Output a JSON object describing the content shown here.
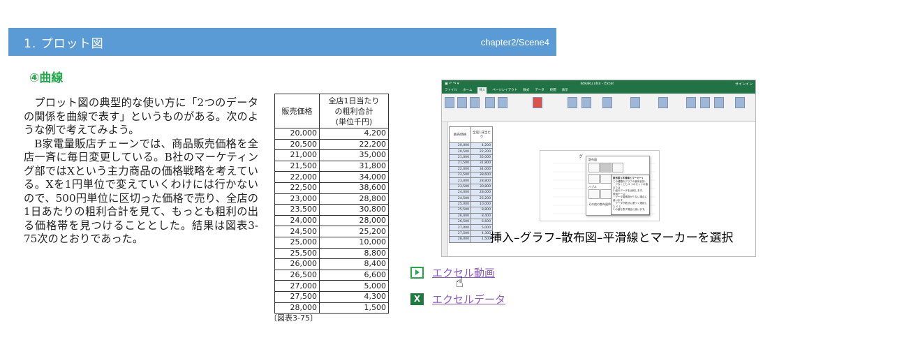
{
  "header": {
    "title": "1. プロット図",
    "scene": "chapter2/Scene4",
    "bg": "#5b9bd5"
  },
  "subtitle": "④曲線",
  "body": {
    "p1": "プロット図の典型的な使い方に「2つのデータの関係を曲線で表す」というものがある。次のような例で考えてみよう。",
    "p2": "B家電量販店チェーンでは、商品販売価格を全店一斉に毎日変更している。B社のマーケティング部ではXという主力商品の価格戦略を考えている。Xを1円単位で変えていくわけには行かないので、500円単位に区切った価格で売り、全店の1日あたりの粗利合計を見て、もっとも粗利の出る価格帯を見つけることとした。結果は図表3-75次のとおりであった。"
  },
  "table": {
    "h1": "販売価格",
    "h2a": "全店1日当たり",
    "h2b": "の粗利合計",
    "h2c": "(単位千円)",
    "rows": [
      [
        "20,000",
        "4,200"
      ],
      [
        "20,500",
        "22,200"
      ],
      [
        "21,000",
        "35,000"
      ],
      [
        "21,500",
        "31,800"
      ],
      [
        "22,000",
        "34,000"
      ],
      [
        "22,500",
        "38,600"
      ],
      [
        "23,000",
        "28,800"
      ],
      [
        "23,500",
        "30,800"
      ],
      [
        "24,000",
        "28,000"
      ],
      [
        "24,500",
        "25,200"
      ],
      [
        "25,000",
        "10,000"
      ],
      [
        "25,500",
        "8,800"
      ],
      [
        "26,000",
        "8,400"
      ],
      [
        "26,500",
        "6,600"
      ],
      [
        "27,000",
        "5,000"
      ],
      [
        "27,500",
        "4,300"
      ],
      [
        "28,000",
        "1,500"
      ]
    ]
  },
  "caption": "〔図表3-75〕",
  "screenshot": {
    "file": "kokaku.xlsx - Excel",
    "signin": "サインイン",
    "tabs": [
      "ファイル",
      "ホーム",
      "挿入",
      "ページレイアウト",
      "数式",
      "データ",
      "校閲",
      "表示"
    ],
    "active_tab": "挿入",
    "search": "実行したい作業を入力してください",
    "popup_title": "散布図",
    "popup_bubble": "バブル",
    "popup_more": "その他の散布図(M)...",
    "tooltip_title": "散布図 (平滑線とマーカー)",
    "tooltip_l1": "この種類のグラフの使用目的:",
    "tooltip_l2": "・少なくとも 2 つのセットの値または",
    "tooltip_l3": "2 組のデータを比較します。",
    "tooltip_l4": "使用ケース:",
    "tooltip_l5": "・データ要素数が少ない場合に使います。",
    "tooltip_l6": "・データが数式に基づく連続した X と",
    "tooltip_l7": "Y の値を表す場合に使います。",
    "chart_title": "グ"
  },
  "overlay_text": "挿入–グラフ–散布図–平滑線とマーカーを選択",
  "links": {
    "video": "エクセル動画",
    "data": "エクセルデータ"
  },
  "colors": {
    "green": "#22a84a",
    "link": "#8a5cc0",
    "excel": "#217346"
  }
}
